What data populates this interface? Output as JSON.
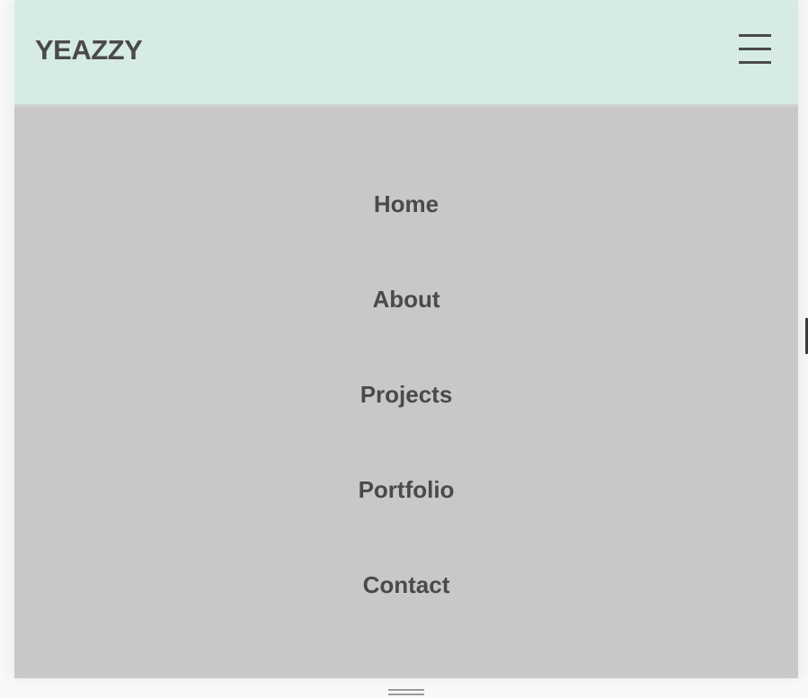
{
  "header": {
    "brand": "YEAZZY",
    "menu_icon": "hamburger-menu-icon"
  },
  "nav": {
    "items": [
      {
        "label": "Home"
      },
      {
        "label": "About"
      },
      {
        "label": "Projects"
      },
      {
        "label": "Portfolio"
      },
      {
        "label": "Contact"
      }
    ]
  },
  "colors": {
    "header_background": "#d6ebe5",
    "menu_background": "#c8c8c8",
    "text": "#4a4a4a",
    "page_background": "#f7f8fa"
  },
  "icons": {
    "resize_handle": "drag-handle-icon",
    "side_tab": "side-tab-icon"
  }
}
